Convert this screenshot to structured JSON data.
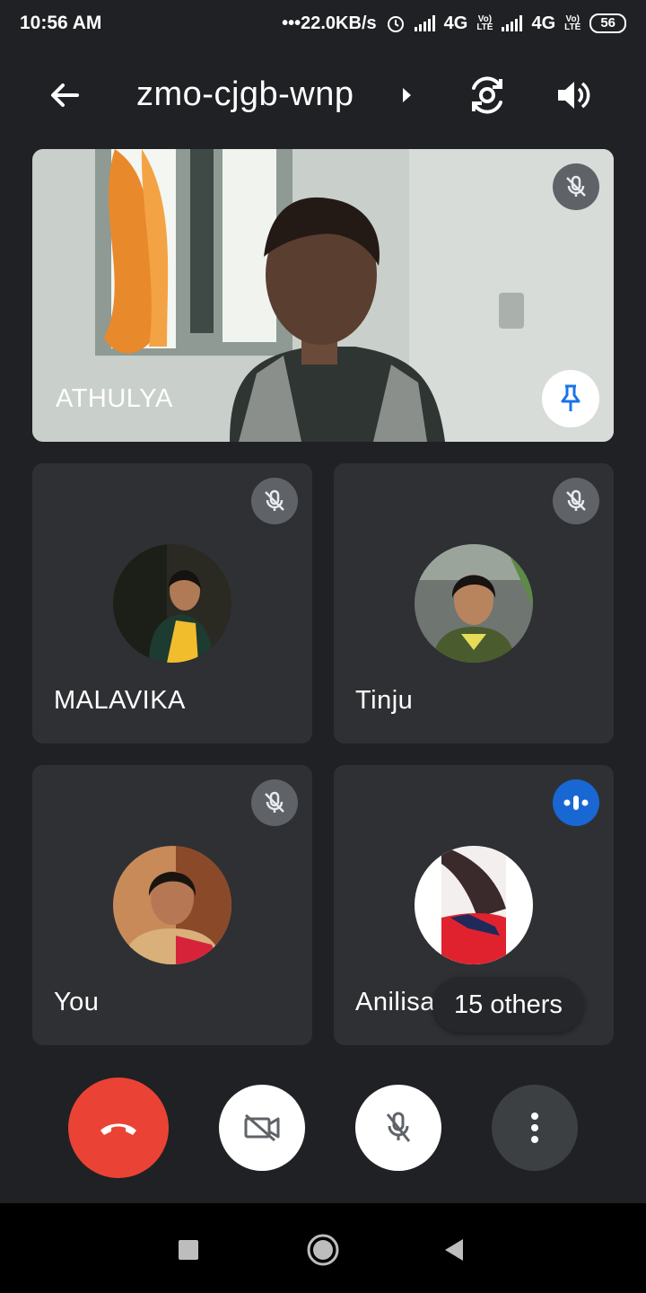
{
  "status_bar": {
    "time": "10:56 AM",
    "network_speed": "22.0KB/s",
    "network_type_1": "4G",
    "network_type_2": "4G",
    "volte_label": "Vo) LTE",
    "battery": "56"
  },
  "header": {
    "meeting_code": "zmo-cjgb-wnp"
  },
  "participants": {
    "main": {
      "name": "ATHULYA",
      "mic_state": "muted",
      "pinned": true
    },
    "tiles": [
      {
        "name": "MALAVIKA",
        "mic_state": "muted"
      },
      {
        "name": "Tinju",
        "mic_state": "muted"
      },
      {
        "name": "You",
        "mic_state": "muted"
      },
      {
        "name": "Anilisa",
        "mic_state": "speaking"
      }
    ],
    "others_label": "15 others"
  },
  "controls": {
    "end_call_color": "#ea4335",
    "camera_state": "off",
    "mic_state": "off"
  },
  "colors": {
    "background": "#202124",
    "tile": "#3c4043",
    "speaking_blue": "#1967d2",
    "pin_blue": "#1a73e8"
  }
}
